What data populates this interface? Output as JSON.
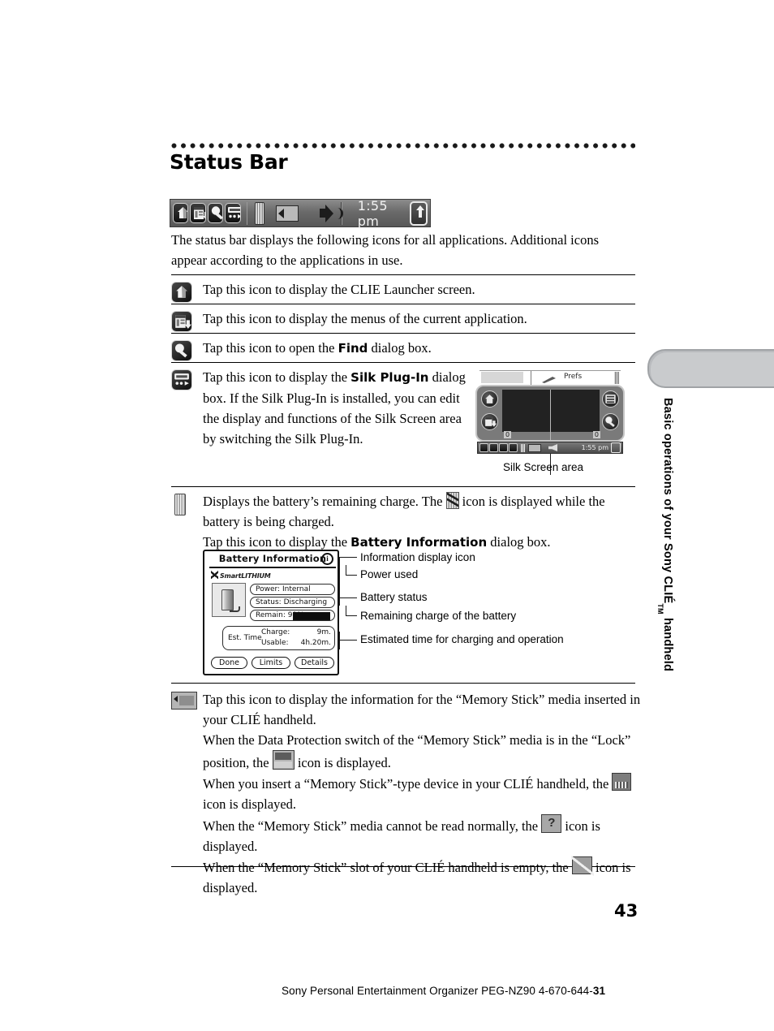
{
  "page": {
    "number": "43",
    "heading": "Status Bar",
    "side_tab_label": "Basic operations of your Sony CLIÉ",
    "side_tab_label_tm": "TM",
    "side_tab_label_tail": " handheld",
    "footer": "Sony Personal Entertainment Organizer  PEG-NZ90  4-670-644-",
    "footer_bold": "31"
  },
  "status_bar": {
    "time": "1:55 pm",
    "icons": [
      "clie-launcher-icon",
      "menu-icon",
      "find-icon",
      "silk-plugin-icon"
    ],
    "battery": "battery-icon",
    "memory_stick": "memory-stick-icon",
    "speaker": "speaker-icon",
    "arrow": "up-arrow-icon"
  },
  "intro": "The status bar displays the following icons for all applications. Additional icons appear according to the applications in use.",
  "rows": [
    {
      "icon": "clie-launcher-icon",
      "text_pre": "Tap this icon to display the CLIE Launcher screen.",
      "text_bold": "",
      "text_post": ""
    },
    {
      "icon": "menu-icon",
      "text_pre": "Tap this icon to display the menus of the current application.",
      "text_bold": "",
      "text_post": ""
    },
    {
      "icon": "find-icon",
      "text_pre": "Tap this icon to open the ",
      "text_bold": "Find",
      "text_post": " dialog box."
    },
    {
      "icon": "silk-plugin-icon",
      "text_pre": "Tap this icon to display the ",
      "text_bold": "Silk Plug-In",
      "text_post": " dialog box.",
      "text_extra": "If the Silk Plug-In is installed, you can edit the display and functions of the Silk Screen area by switching the Silk Plug-In."
    }
  ],
  "silk_figure": {
    "prefs_label": "Prefs",
    "zero_left": "0",
    "zero_right": "0",
    "bar_time": "1:55 pm",
    "caption": "Silk Screen area"
  },
  "battery_row": {
    "line1_pre": "Displays the battery’s remaining charge. The ",
    "line1_post": " icon is displayed while the battery is being charged.",
    "line2_pre": "Tap this icon to display the ",
    "line2_bold": "Battery Information",
    "line2_post": " dialog box."
  },
  "battery_dialog": {
    "title": "Battery Information",
    "info_icon_glyph": "i",
    "brand": "SmartLITHIUM",
    "fields": [
      {
        "label": "Power:",
        "value": "Internal"
      },
      {
        "label": "Status:",
        "value": "Discharging"
      },
      {
        "label": "Remain:",
        "value": "91%"
      }
    ],
    "est": {
      "title": "Est. Time",
      "rows": [
        {
          "label": "Charge:",
          "value": "9m."
        },
        {
          "label": "Usable:",
          "value": "4h.20m."
        }
      ]
    },
    "buttons": [
      "Done",
      "Limits",
      "Details"
    ],
    "callouts": [
      "Information display icon",
      "Power used",
      "Battery status",
      "Remaining charge of the battery",
      "Estimated time for charging and operation"
    ]
  },
  "memory_stick_row": {
    "p1_pre": " Tap this icon to display the information for the “Memory Stick” media inserted in your CLIÉ handheld.",
    "p2_pre": "When the Data Protection switch of the “Memory Stick” media is in the “Lock” position, the ",
    "p2_post": " icon is displayed.",
    "p3_pre": "When you insert a “Memory Stick”-type device in your CLIÉ handheld, the ",
    "p3_post": " icon is displayed.",
    "p4_pre": "When the “Memory Stick” media cannot be read normally, the ",
    "p4_post": " icon is displayed.",
    "p5_pre": "When the “Memory Stick” slot of your CLIÉ handheld is empty, the ",
    "p5_post": " icon is displayed."
  }
}
